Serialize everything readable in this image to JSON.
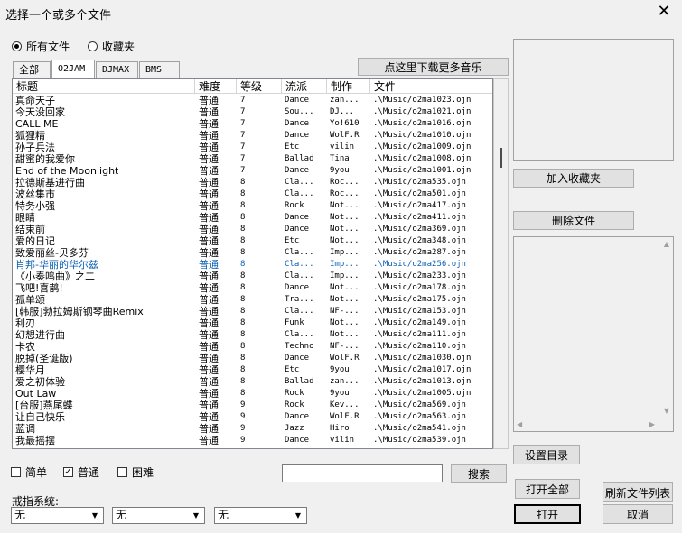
{
  "window": {
    "title": "选择一个或多个文件",
    "close_glyph": "✕"
  },
  "scope": {
    "all_files": "所有文件",
    "favorites": "收藏夹",
    "selected": "all_files"
  },
  "tabs": [
    "全部",
    "O2JAM",
    "DJMAX",
    "BMS"
  ],
  "active_tab": 1,
  "download_button": "点这里下载更多音乐",
  "columns": [
    "标题",
    "难度",
    "等级",
    "流派",
    "制作",
    "文件"
  ],
  "rows": [
    [
      "真命天子",
      "普通",
      "7",
      "Dance",
      "zan...",
      ".\\Music/o2ma1023.ojn"
    ],
    [
      "今天没回家",
      "普通",
      "7",
      "Sou...",
      "DJ...",
      ".\\Music/o2ma1021.ojn"
    ],
    [
      "CALL ME",
      "普通",
      "7",
      "Dance",
      "Yo!610",
      ".\\Music/o2ma1016.ojn"
    ],
    [
      "狐狸精",
      "普通",
      "7",
      "Dance",
      "WolF.R",
      ".\\Music/o2ma1010.ojn"
    ],
    [
      "孙子兵法",
      "普通",
      "7",
      "Etc",
      "vilin",
      ".\\Music/o2ma1009.ojn"
    ],
    [
      "甜蜜的我爱你",
      "普通",
      "7",
      "Ballad",
      "Tina",
      ".\\Music/o2ma1008.ojn"
    ],
    [
      "End of the Moonlight",
      "普通",
      "7",
      "Dance",
      "9you",
      ".\\Music/o2ma1001.ojn"
    ],
    [
      "拉德斯基进行曲",
      "普通",
      "8",
      "Cla...",
      "Roc...",
      ".\\Music/o2ma535.ojn"
    ],
    [
      "波丝集市",
      "普通",
      "8",
      "Cla...",
      "Roc...",
      ".\\Music/o2ma501.ojn"
    ],
    [
      "特务小强",
      "普通",
      "8",
      "Rock",
      "Not...",
      ".\\Music/o2ma417.ojn"
    ],
    [
      "眼睛",
      "普通",
      "8",
      "Dance",
      "Not...",
      ".\\Music/o2ma411.ojn"
    ],
    [
      "结束前",
      "普通",
      "8",
      "Dance",
      "Not...",
      ".\\Music/o2ma369.ojn"
    ],
    [
      "爱的日记",
      "普通",
      "8",
      "Etc",
      "Not...",
      ".\\Music/o2ma348.ojn"
    ],
    [
      "致爱丽丝-贝多芬",
      "普通",
      "8",
      "Cla...",
      "Imp...",
      ".\\Music/o2ma287.ojn"
    ],
    [
      "肖邦-华丽的华尔兹",
      "普通",
      "8",
      "Cla...",
      "Imp...",
      ".\\Music/o2ma256.ojn"
    ],
    [
      "《小奏鸣曲》之二",
      "普通",
      "8",
      "Cla...",
      "Imp...",
      ".\\Music/o2ma233.ojn"
    ],
    [
      "飞吧!喜鹊!",
      "普通",
      "8",
      "Dance",
      "Not...",
      ".\\Music/o2ma178.ojn"
    ],
    [
      "孤单颂",
      "普通",
      "8",
      "Tra...",
      "Not...",
      ".\\Music/o2ma175.ojn"
    ],
    [
      "[韩服]勃拉姆斯钢琴曲Remix",
      "普通",
      "8",
      "Cla...",
      "NF-...",
      ".\\Music/o2ma153.ojn"
    ],
    [
      "利刃",
      "普通",
      "8",
      "Funk",
      "Not...",
      ".\\Music/o2ma149.ojn"
    ],
    [
      "幻想进行曲",
      "普通",
      "8",
      "Cla...",
      "Not...",
      ".\\Music/o2ma111.ojn"
    ],
    [
      "卡农",
      "普通",
      "8",
      "Techno",
      "NF-...",
      ".\\Music/o2ma110.ojn"
    ],
    [
      "脱掉(圣诞版)",
      "普通",
      "8",
      "Dance",
      "WolF.R",
      ".\\Music/o2ma1030.ojn"
    ],
    [
      "樱华月",
      "普通",
      "8",
      "Etc",
      "9you",
      ".\\Music/o2ma1017.ojn"
    ],
    [
      "爱之初体验",
      "普通",
      "8",
      "Ballad",
      "zan...",
      ".\\Music/o2ma1013.ojn"
    ],
    [
      "Out Law",
      "普通",
      "8",
      "Rock",
      "9you",
      ".\\Music/o2ma1005.ojn"
    ],
    [
      "[台服]燕尾蝶",
      "普通",
      "9",
      "Rock",
      "Kev...",
      ".\\Music/o2ma569.ojn"
    ],
    [
      "让自己快乐",
      "普通",
      "9",
      "Dance",
      "WolF.R",
      ".\\Music/o2ma563.ojn"
    ],
    [
      "蓝调",
      "普通",
      "9",
      "Jazz",
      "Hiro",
      ".\\Music/o2ma541.ojn"
    ],
    [
      "我最摇摆",
      "普通",
      "9",
      "Dance",
      "vilin",
      ".\\Music/o2ma539.ojn"
    ]
  ],
  "selected_row": 14,
  "buttons": {
    "add_favorite": "加入收藏夹",
    "delete_file": "删除文件",
    "set_dir": "设置目录",
    "search": "搜索",
    "open_all": "打开全部",
    "refresh": "刷新文件列表",
    "open": "打开",
    "cancel": "取消"
  },
  "filters": {
    "easy": "简单",
    "normal": "普通",
    "hard": "困难",
    "normal_checked": true
  },
  "ring_system": {
    "label": "戒指系统:",
    "values": [
      "无",
      "无",
      "无"
    ]
  },
  "colors": {
    "selected_row_text": "#0b5fb0"
  }
}
